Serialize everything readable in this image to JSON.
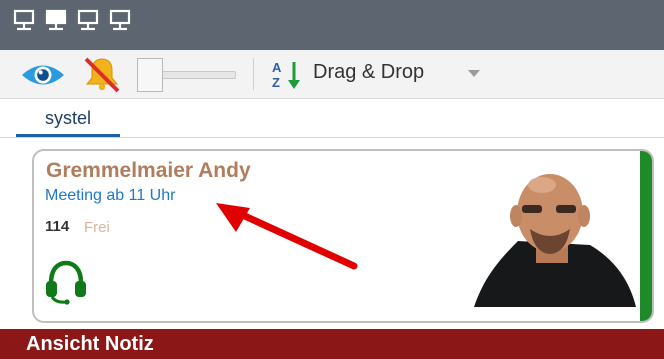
{
  "window": {
    "monitor_icons": [
      "monitor-icon",
      "monitor-icon",
      "monitor-icon",
      "monitor-icon"
    ]
  },
  "toolbar": {
    "eye_icon": "eye-icon",
    "bell_icon": "bell-muted-icon",
    "sort_icon": "sort-az-icon",
    "sort_label": "Drag & Drop",
    "dropdown_icon": "chevron-down-icon"
  },
  "tabs": [
    {
      "label": "systel",
      "active": true
    }
  ],
  "contact": {
    "name": "Gremmelmaier Andy",
    "note": "Meeting ab 11 Uhr",
    "extension": "114",
    "state": "Frei",
    "headset_icon": "headset-icon",
    "status_color": "#1f8a2a"
  },
  "footer": {
    "label": "Ansicht Notiz"
  }
}
